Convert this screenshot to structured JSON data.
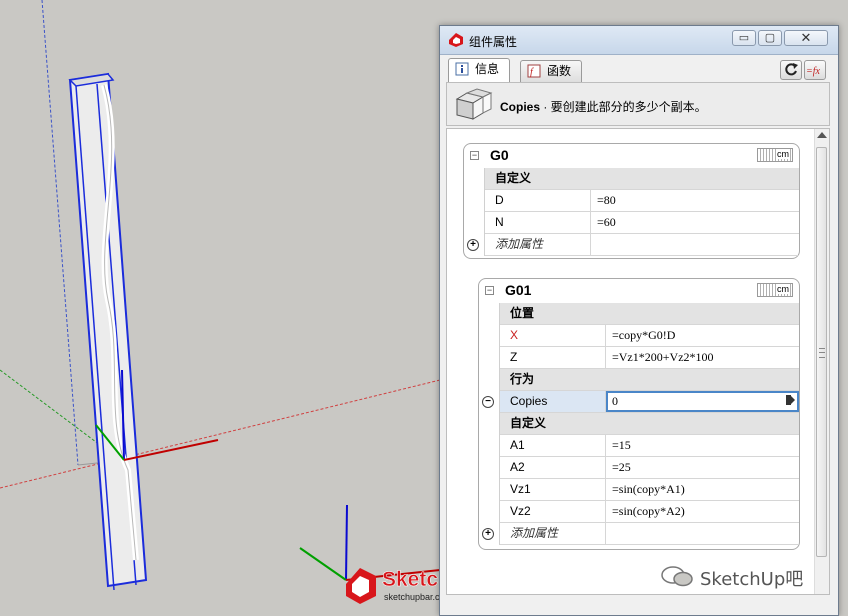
{
  "window": {
    "title": "组件属性",
    "minimize_label": "▭",
    "maximize_label": "▢",
    "close_label": "✕"
  },
  "tabs": [
    {
      "label": "信息",
      "active": true,
      "icon": "info-icon"
    },
    {
      "label": "函数",
      "active": false,
      "icon": "fx-icon"
    }
  ],
  "toolbar": {
    "refresh_icon": "refresh-icon",
    "fx_button_label": "=fx"
  },
  "header": {
    "attribute_name": "Copies",
    "description": " · 要创建此部分的多少个副本。"
  },
  "components": [
    {
      "name": "G0",
      "unit": "cm",
      "groups": [
        {
          "label": "自定义",
          "rows": [
            {
              "key": "D",
              "value": "=80"
            },
            {
              "key": "N",
              "value": "=60"
            }
          ]
        }
      ],
      "add_label": "添加属性"
    },
    {
      "name": "G01",
      "unit": "cm",
      "groups": [
        {
          "label": "位置",
          "rows": [
            {
              "key": "X",
              "value": "=copy*G0!D"
            },
            {
              "key": "Z",
              "value": "=Vz1*200+Vz2*100"
            }
          ]
        },
        {
          "label": "行为",
          "rows": [
            {
              "key": "Copies",
              "value": "0"
            }
          ]
        },
        {
          "label": "自定义",
          "rows": [
            {
              "key": "A1",
              "value": "=15"
            },
            {
              "key": "A2",
              "value": "=25"
            },
            {
              "key": "Vz1",
              "value": "=sin(copy*A1)"
            },
            {
              "key": "Vz2",
              "value": "=sin(copy*A2)"
            }
          ]
        }
      ],
      "add_label": "添加属性"
    }
  ],
  "branding": {
    "logo_text": "SketchUp吧",
    "logo_url_text": "sketchupbar.com",
    "watermark": "SketchUp吧"
  },
  "colors": {
    "selection_border": "#4a86c8",
    "red_key": "#c81e1e",
    "axis_red": "#c00000",
    "axis_green": "#00a000",
    "axis_blue": "#0000d0"
  }
}
